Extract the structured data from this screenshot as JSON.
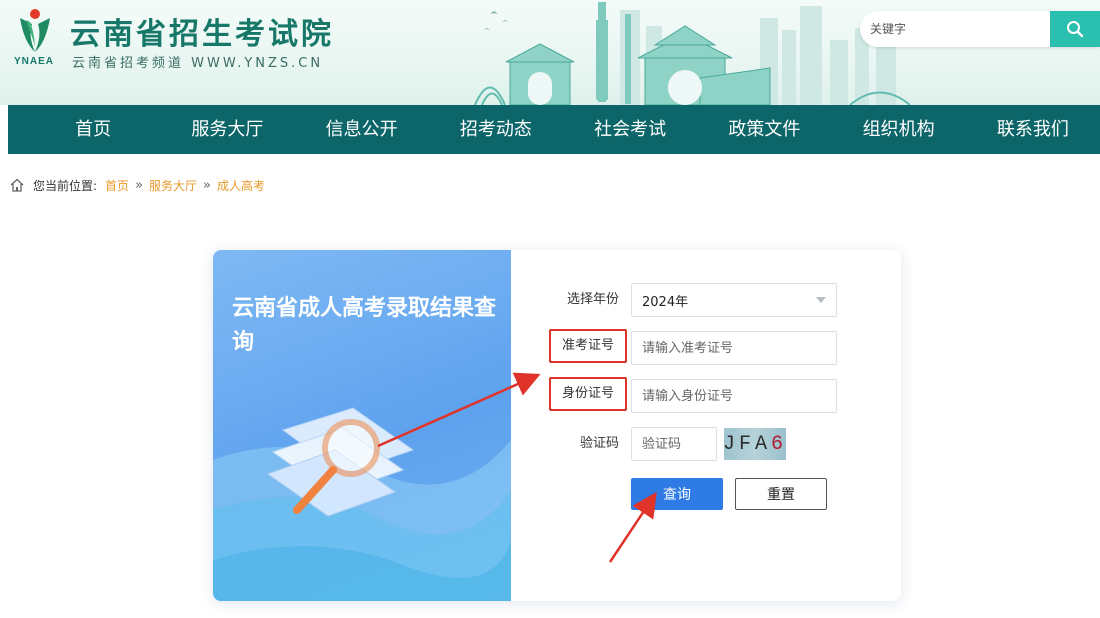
{
  "header": {
    "site_title": "云南省招生考试院",
    "logo_en": "YNAEA",
    "site_sub": "云南省招考频道 WWW.YNZS.CN",
    "search": {
      "placeholder": "关键字",
      "value": ""
    }
  },
  "nav": {
    "items": [
      {
        "label": "首页"
      },
      {
        "label": "服务大厅"
      },
      {
        "label": "信息公开"
      },
      {
        "label": "招考动态"
      },
      {
        "label": "社会考试"
      },
      {
        "label": "政策文件"
      },
      {
        "label": "组织机构"
      },
      {
        "label": "联系我们"
      }
    ]
  },
  "breadcrumb": {
    "prefix": "您当前位置:",
    "items": [
      "首页",
      "服务大厅",
      "成人高考"
    ],
    "separator": "»"
  },
  "card": {
    "title": "云南省成人高考录取结果查询",
    "form": {
      "year_label": "选择年份",
      "year_value": "2024年",
      "exam_no_label": "准考证号",
      "exam_no_placeholder": "请输入准考证号",
      "id_label": "身份证号",
      "id_placeholder": "请输入身份证号",
      "captcha_label": "验证码",
      "captcha_placeholder": "验证码",
      "captcha_text_main": "JFA",
      "captcha_text_last": "6",
      "query_button": "查询",
      "reset_button": "重置"
    }
  },
  "colors": {
    "brand": "#17786a",
    "nav_bg": "#0c6568",
    "search_btn": "#2bbfb0",
    "link_orange": "#e8982a",
    "primary_button": "#2e7be5",
    "annotation_red": "#e0332a"
  },
  "icons": [
    "logo-icon",
    "search-icon",
    "home-icon",
    "chevron-down-icon",
    "magnifier-illustration"
  ]
}
